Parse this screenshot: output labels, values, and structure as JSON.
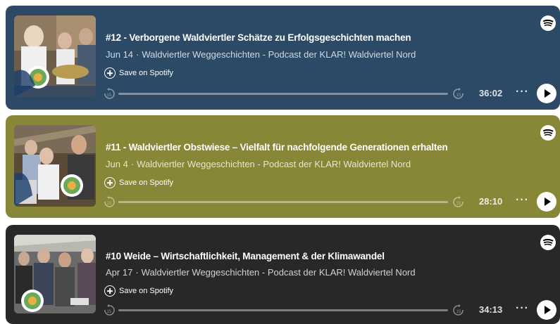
{
  "episodes": [
    {
      "title": "#12 - Verborgene Waldviertler Schätze zu Erfolgsgeschichten machen",
      "date": "Jun 14",
      "show": "Waldviertler Weggeschichten - Podcast der KLAR! Waldviertel Nord",
      "save_label": "Save on Spotify",
      "duration": "36:02",
      "progress": 0,
      "bg_color": "#2c4a66"
    },
    {
      "title": "#11 - Waldviertler Obstwiese – Vielfalt für nachfolgende Generationen erhalten",
      "date": "Jun 4",
      "show": "Waldviertler Weggeschichten - Podcast der KLAR! Waldviertel Nord",
      "save_label": "Save on Spotify",
      "duration": "28:10",
      "progress": 0,
      "bg_color": "#888737"
    },
    {
      "title": "#10 Weide – Wirtschaftlichkeit, Management & der Klimawandel",
      "date": "Apr 17",
      "show": "Waldviertler Weggeschichten - Podcast der KLAR! Waldviertel Nord",
      "save_label": "Save on Spotify",
      "duration": "34:13",
      "progress": 0,
      "bg_color": "#282828"
    }
  ],
  "controls": {
    "more_label": "···",
    "skip_back_icon": "skip-back-15-icon",
    "skip_forward_icon": "skip-forward-15-icon",
    "play_icon": "play-icon",
    "brand_icon": "spotify-logo-icon"
  }
}
